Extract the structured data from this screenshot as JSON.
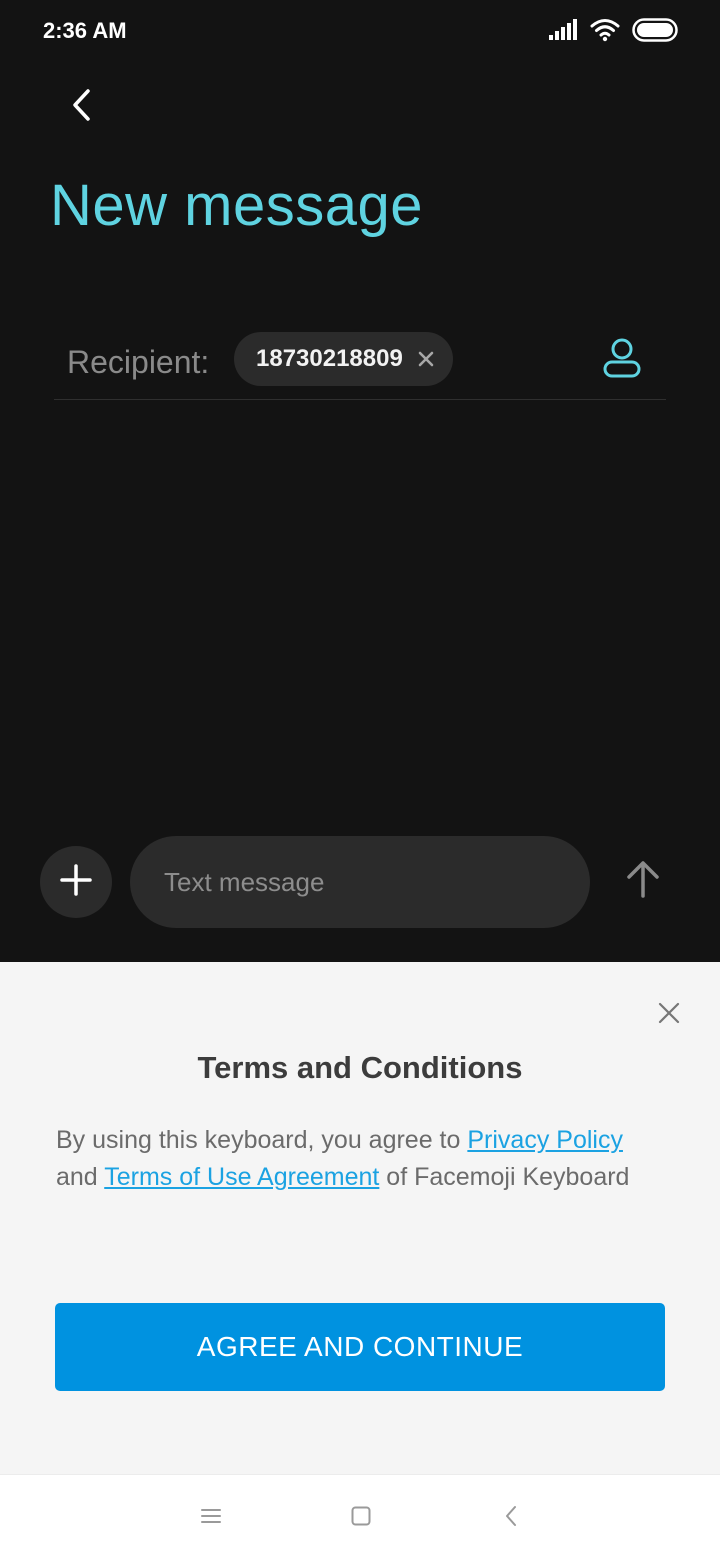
{
  "status_bar": {
    "time": "2:36 AM",
    "icons": [
      "signal-icon",
      "wifi-icon",
      "battery-icon"
    ]
  },
  "header": {
    "back_icon": "chevron-left-icon",
    "title": "New message"
  },
  "recipient": {
    "label": "Recipient:",
    "chip_value": "18730218809",
    "chip_remove_icon": "close-icon",
    "contact_icon": "person-icon"
  },
  "composer": {
    "attach_icon": "plus-icon",
    "placeholder": "Text message",
    "send_icon": "arrow-up-icon"
  },
  "terms": {
    "title": "Terms and Conditions",
    "body_prefix": "By using this keyboard, you agree to ",
    "privacy_link": "Privacy Policy",
    "body_middle": " and ",
    "terms_link": "Terms of Use Agreement",
    "body_suffix": " of Facemoji Keyboard",
    "agree_label": "AGREE AND CONTINUE",
    "close_icon": "close-icon"
  },
  "nav_bar": {
    "icons": [
      "menu-icon",
      "home-icon",
      "back-icon"
    ]
  },
  "colors": {
    "accent": "#5fd3e1",
    "background": "#131313",
    "button_blue": "#0092e0",
    "link_blue": "#1ba2e2",
    "sheet_background": "#f5f5f5"
  }
}
